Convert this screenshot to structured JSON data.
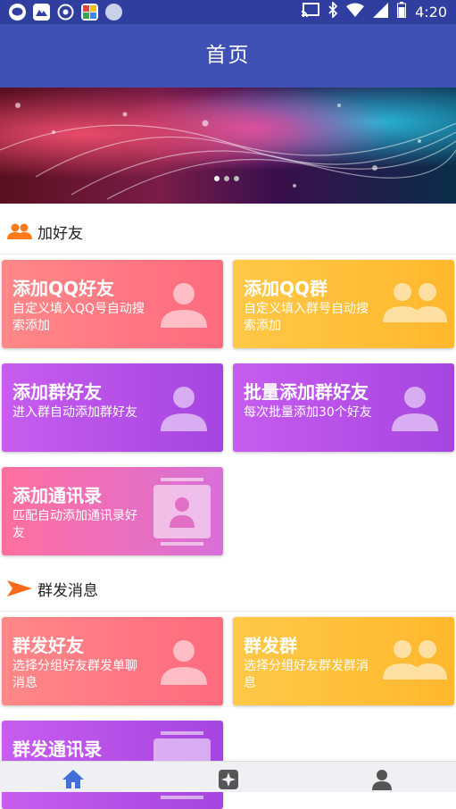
{
  "status_bar": {
    "time": "4:20",
    "left_icons": [
      "chat-icon",
      "image-icon",
      "flower-icon",
      "photos-icon",
      "circle-app-icon"
    ],
    "right_icons": [
      "cast-icon",
      "bluetooth-icon",
      "wifi-icon",
      "signal-icon",
      "battery-icon"
    ]
  },
  "app_bar": {
    "title": "首页"
  },
  "banner": {
    "dots": 3,
    "active_dot": 1
  },
  "sections": [
    {
      "title": "加好友",
      "icon": "people-icon",
      "cards": [
        {
          "title": "添加QQ好友",
          "desc": "自定义填入QQ号自动搜索添加",
          "color": "#ff7a85",
          "icon": "person-icon"
        },
        {
          "title": "添加QQ群",
          "desc": "自定义填入群号自动搜索添加",
          "color": "#ffc03a",
          "icon": "group-icon"
        },
        {
          "title": "添加群好友",
          "desc": "进入群自动添加群好友",
          "color": "#b94fe8",
          "icon": "person-icon"
        },
        {
          "title": "批量添加群好友",
          "desc": "每次批量添加30个好友",
          "color": "#b94fe8",
          "icon": "person-icon"
        },
        {
          "title": "添加通讯录",
          "desc": "匹配自动添加通讯录好友",
          "color": "#f06fb5",
          "icon": "contact-card-icon"
        }
      ]
    },
    {
      "title": "群发消息",
      "icon": "send-icon",
      "cards": [
        {
          "title": "群发好友",
          "desc": "选择分组好友群发单聊消息",
          "color": "#ff7a85",
          "icon": "person-icon"
        },
        {
          "title": "群发群",
          "desc": "选择分组好友群发群消息",
          "color": "#ffc03a",
          "icon": "group-icon"
        },
        {
          "title": "群发通讯录",
          "desc": "",
          "color": "#b94fe8",
          "icon": "contact-card-icon"
        }
      ]
    }
  ],
  "tabs": [
    {
      "name": "home",
      "icon": "home-icon",
      "color": "#3f6fd8",
      "active": true
    },
    {
      "name": "discover",
      "icon": "sparkle-icon",
      "color": "#555555",
      "active": false
    },
    {
      "name": "me",
      "icon": "user-icon",
      "color": "#555555",
      "active": false
    }
  ]
}
